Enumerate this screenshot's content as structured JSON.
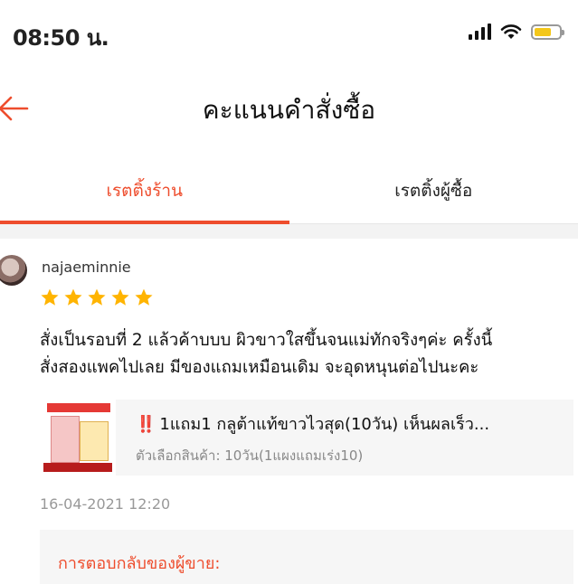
{
  "status_bar": {
    "time": "08:50 น."
  },
  "header": {
    "title": "คะแนนคำสั่งซื้อ"
  },
  "tabs": [
    {
      "label": "เรตติ้งร้าน",
      "active": true
    },
    {
      "label": "เรตติ้งผู้ซื้อ",
      "active": false
    }
  ],
  "review": {
    "username": "najaeminnie",
    "rating": 5,
    "comment_line1": "สั่งเป็นรอบที่ 2 แล้วค้าบบบ ผิวขาวใสขึ้นจนแม่ทักจริงๆค่ะ ครั้งนี้",
    "comment_line2": "สั่งสองแพคไปเลย มีของแถมเหมือนเดิม จะอุดหนุนต่อไปนะคะ",
    "product": {
      "name_prefix": "‼️",
      "name": "1แถม1 กลูต้าแท้ขาวไวสุด(10วัน) เห็นผลเร็ว...",
      "variation": "ตัวเลือกสินค้า: 10วัน(1แผงแถมเร่ง10)"
    },
    "date": "16-04-2021 12:20",
    "seller_reply_label": "การตอบกลับของผู้ขาย:"
  },
  "colors": {
    "accent": "#ee4d2d",
    "star": "#ffb400"
  },
  "icons": [
    "back-arrow-icon",
    "signal-icon",
    "wifi-icon",
    "battery-icon",
    "star-icon"
  ]
}
